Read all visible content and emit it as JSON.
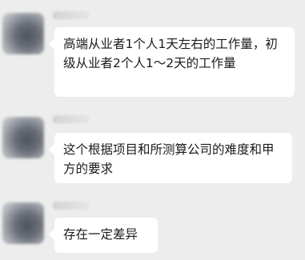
{
  "messages": [
    {
      "text": "高端从业者1个人1天左右的工作量，初级从业者2个人1～2天的工作量"
    },
    {
      "text": "这个根据项目和所测算公司的难度和甲方的要求"
    },
    {
      "text": "存在一定差异"
    }
  ]
}
